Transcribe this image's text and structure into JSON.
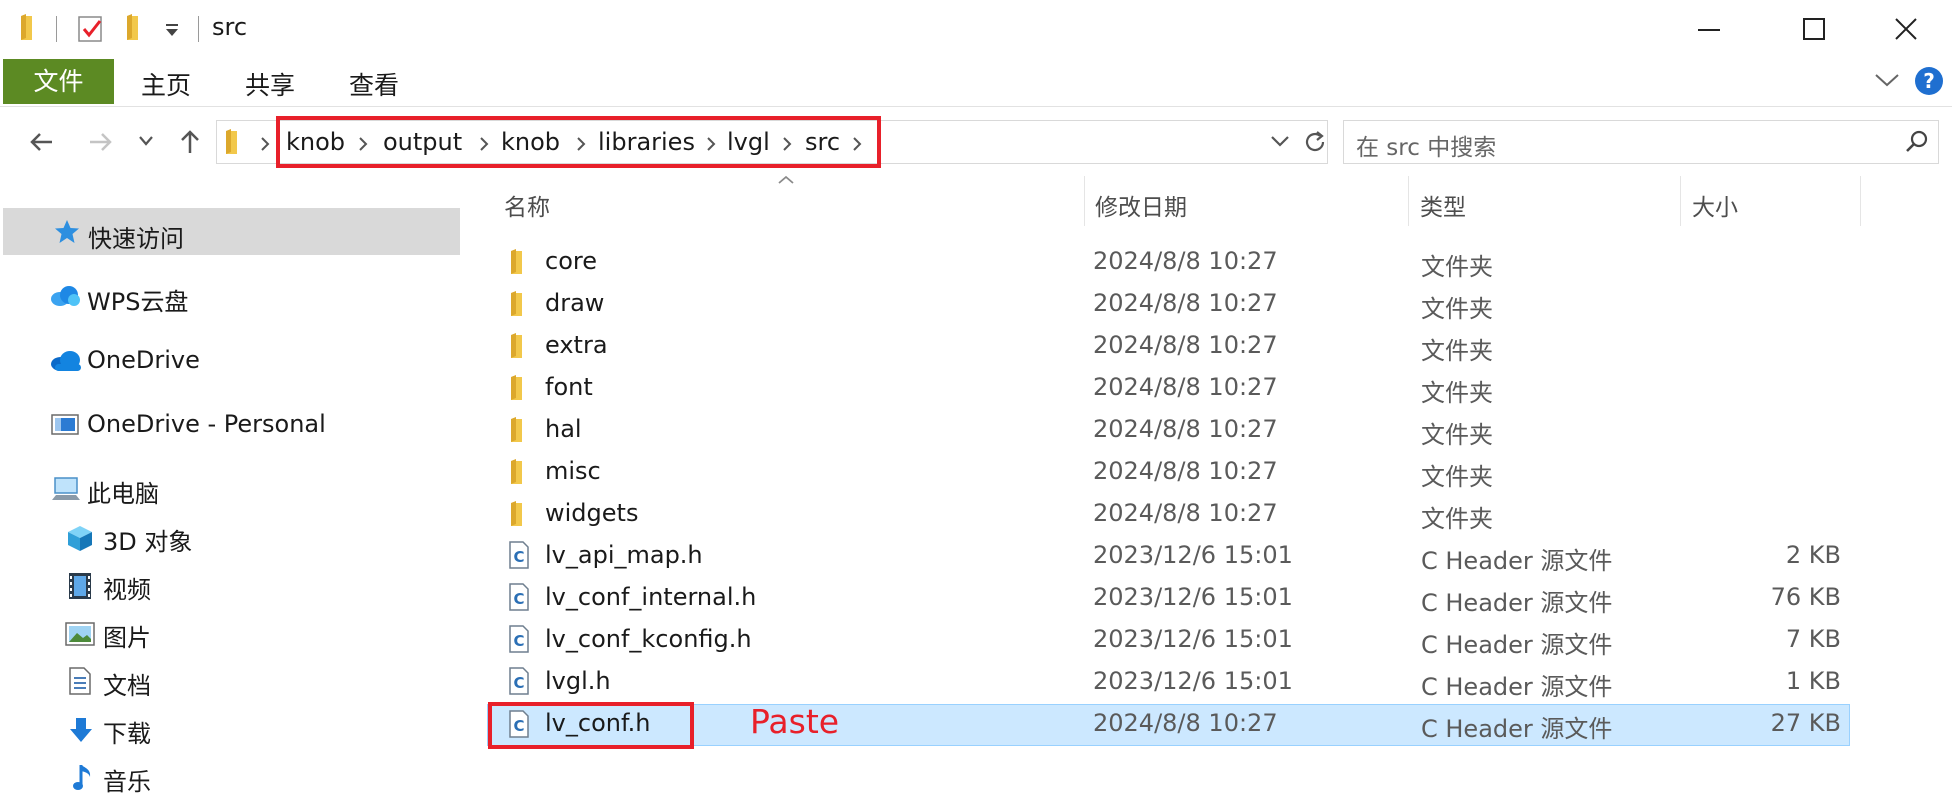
{
  "window": {
    "title": "src"
  },
  "ribbon": {
    "tabs": [
      {
        "label": "文件",
        "active": true
      },
      {
        "label": "主页"
      },
      {
        "label": "共享"
      },
      {
        "label": "查看"
      }
    ]
  },
  "address": {
    "breadcrumbs": [
      "knob",
      "output",
      "knob",
      "libraries",
      "lvgl",
      "src"
    ]
  },
  "search": {
    "placeholder": "在 src 中搜索"
  },
  "sidebar": {
    "items": [
      {
        "label": "快速访问",
        "icon": "star-icon"
      },
      {
        "label": "WPS云盘",
        "icon": "cloud-icon"
      },
      {
        "label": "OneDrive",
        "icon": "onedrive-icon"
      },
      {
        "label": "OneDrive - Personal",
        "icon": "onedrive-personal-icon"
      },
      {
        "label": "此电脑",
        "icon": "computer-icon"
      },
      {
        "label": "3D 对象",
        "icon": "cube-icon"
      },
      {
        "label": "视频",
        "icon": "video-icon"
      },
      {
        "label": "图片",
        "icon": "picture-icon"
      },
      {
        "label": "文档",
        "icon": "document-icon"
      },
      {
        "label": "下载",
        "icon": "download-icon"
      },
      {
        "label": "音乐",
        "icon": "music-icon"
      }
    ]
  },
  "columns": {
    "name": "名称",
    "date": "修改日期",
    "type": "类型",
    "size": "大小"
  },
  "files": [
    {
      "name": "core",
      "date": "2024/8/8 10:27",
      "type": "文件夹",
      "size": "",
      "kind": "folder"
    },
    {
      "name": "draw",
      "date": "2024/8/8 10:27",
      "type": "文件夹",
      "size": "",
      "kind": "folder"
    },
    {
      "name": "extra",
      "date": "2024/8/8 10:27",
      "type": "文件夹",
      "size": "",
      "kind": "folder"
    },
    {
      "name": "font",
      "date": "2024/8/8 10:27",
      "type": "文件夹",
      "size": "",
      "kind": "folder"
    },
    {
      "name": "hal",
      "date": "2024/8/8 10:27",
      "type": "文件夹",
      "size": "",
      "kind": "folder"
    },
    {
      "name": "misc",
      "date": "2024/8/8 10:27",
      "type": "文件夹",
      "size": "",
      "kind": "folder"
    },
    {
      "name": "widgets",
      "date": "2024/8/8 10:27",
      "type": "文件夹",
      "size": "",
      "kind": "folder"
    },
    {
      "name": "lv_api_map.h",
      "date": "2023/12/6 15:01",
      "type": "C Header 源文件",
      "size": "2 KB",
      "kind": "file"
    },
    {
      "name": "lv_conf_internal.h",
      "date": "2023/12/6 15:01",
      "type": "C Header 源文件",
      "size": "76 KB",
      "kind": "file"
    },
    {
      "name": "lv_conf_kconfig.h",
      "date": "2023/12/6 15:01",
      "type": "C Header 源文件",
      "size": "7 KB",
      "kind": "file"
    },
    {
      "name": "lvgl.h",
      "date": "2023/12/6 15:01",
      "type": "C Header 源文件",
      "size": "1 KB",
      "kind": "file"
    },
    {
      "name": "lv_conf.h",
      "date": "2024/8/8 10:27",
      "type": "C Header 源文件",
      "size": "27 KB",
      "kind": "file",
      "selected": true
    }
  ],
  "annotation": {
    "text": "Paste",
    "color": "#e8202a"
  },
  "colors": {
    "file_tab": "#5c8a23",
    "selection": "#cce8ff",
    "folder": "#f2c84b",
    "annotation_box": "#e8202a"
  }
}
